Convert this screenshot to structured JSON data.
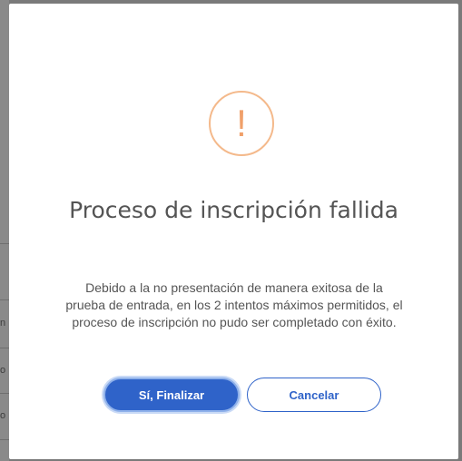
{
  "backdrop": {
    "glyphs": [
      "n",
      "o",
      "o"
    ]
  },
  "dialog": {
    "icon": "exclamation-icon",
    "icon_glyph": "!",
    "icon_color": "#f0a06a",
    "title": "Proceso de inscripción fallida",
    "message": "Debido a la no presentación de manera exitosa de la prueba de entrada, en los 2 intentos máximos permitidos, el proceso de inscripción no pudo ser completado con éxito.",
    "confirm_label": "Sí, Finalizar",
    "cancel_label": "Cancelar",
    "accent_color": "#2f63c9"
  }
}
